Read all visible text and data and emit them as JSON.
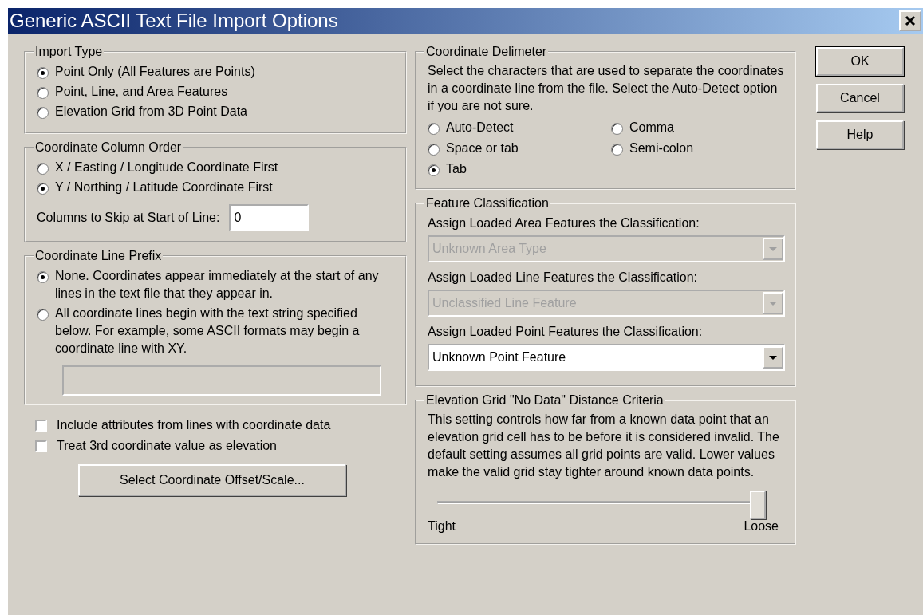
{
  "window": {
    "title": "Generic ASCII Text File Import Options"
  },
  "import_type": {
    "legend": "Import Type",
    "options": [
      {
        "label": "Point Only (All Features are Points)",
        "selected": true
      },
      {
        "label": "Point, Line, and Area Features",
        "selected": false
      },
      {
        "label": "Elevation Grid from 3D Point Data",
        "selected": false
      }
    ]
  },
  "column_order": {
    "legend": "Coordinate Column Order",
    "options": [
      {
        "label": "X / Easting / Longitude Coordinate First",
        "selected": false
      },
      {
        "label": "Y / Northing / Latitude Coordinate First",
        "selected": true
      }
    ],
    "skip_label": "Columns to Skip at Start of Line:",
    "skip_value": "0"
  },
  "line_prefix": {
    "legend": "Coordinate Line Prefix",
    "options": [
      {
        "label": "None. Coordinates appear immediately at the start of any lines in the text file that they appear in.",
        "selected": true
      },
      {
        "label": "All coordinate lines begin with the text string specified below. For example, some ASCII formats may begin a coordinate line with XY.",
        "selected": false
      }
    ],
    "prefix_field": {
      "disabled": true
    }
  },
  "checkboxes": [
    {
      "label": "Include attributes from lines with coordinate data",
      "checked": false
    },
    {
      "label": "Treat 3rd coordinate value as elevation",
      "checked": false
    }
  ],
  "offset_button": "Select Coordinate Offset/Scale...",
  "delimiter": {
    "legend": "Coordinate Delimeter",
    "description": "Select the characters that are used to separate the coordinates in a coordinate line from the file. Select the Auto-Detect option if you are not sure.",
    "options": [
      {
        "label": "Auto-Detect",
        "selected": false
      },
      {
        "label": "Comma",
        "selected": false
      },
      {
        "label": "Space or tab",
        "selected": false
      },
      {
        "label": "Semi-colon",
        "selected": false
      },
      {
        "label": "Tab",
        "selected": true
      }
    ]
  },
  "feature_classification": {
    "legend": "Feature Classification",
    "fields": [
      {
        "label": "Assign Loaded Area Features the Classification:",
        "value": "Unknown Area Type",
        "disabled": true
      },
      {
        "label": "Assign Loaded Line Features the Classification:",
        "value": "Unclassified Line Feature",
        "disabled": true
      },
      {
        "label": "Assign Loaded Point Features the Classification:",
        "value": "Unknown Point Feature",
        "disabled": false
      }
    ]
  },
  "distance": {
    "legend": "Elevation Grid \"No Data\" Distance Criteria",
    "description": "This setting controls how far from a known data point that an elevation grid cell has to be before it is considered invalid. The default setting assumes all grid points are valid. Lower values make the valid grid stay tighter around known data points.",
    "slider": {
      "level": 1,
      "min_label": "Tight",
      "max_label": "Loose"
    }
  },
  "buttons": [
    {
      "label": "OK",
      "default": true
    },
    {
      "label": "Cancel",
      "default": false
    },
    {
      "label": "Help",
      "default": false
    }
  ]
}
